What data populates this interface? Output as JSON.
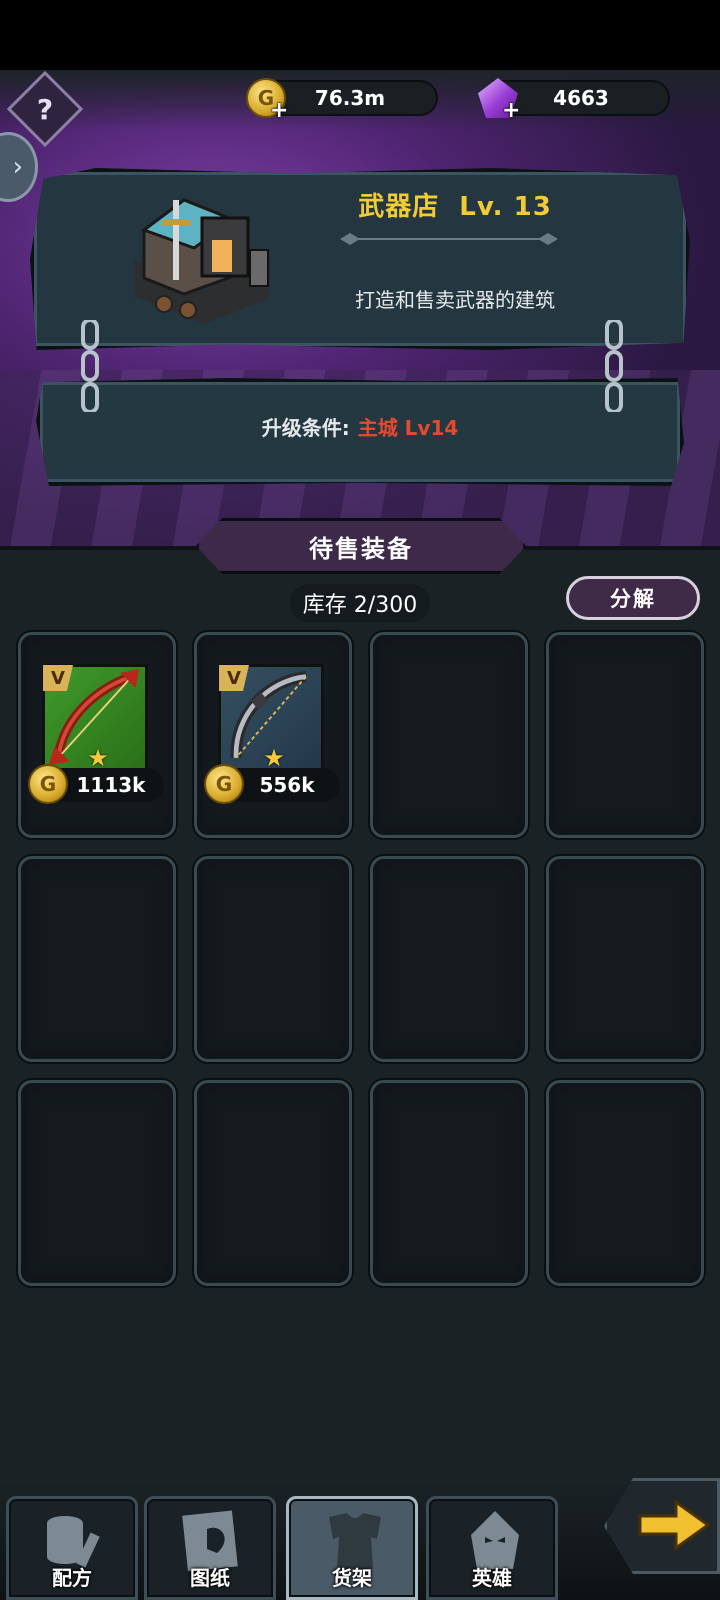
{
  "currencies": {
    "gold": "76.3m",
    "gems": "4663"
  },
  "building": {
    "name": "武器店",
    "level": "Lv. 13",
    "description": "打造和售卖武器的建筑"
  },
  "upgrade": {
    "label": "升级条件:",
    "requirement": "主城 Lv14"
  },
  "section": {
    "title": "待售装备",
    "stock": "库存 2/300",
    "decompose_label": "分解"
  },
  "items": [
    {
      "grade": "V",
      "price": "1113k",
      "rarity": "green",
      "stars": 1
    },
    {
      "grade": "V",
      "price": "556k",
      "rarity": "blue",
      "stars": 1
    }
  ],
  "nav": {
    "tabs": [
      {
        "label": "配方",
        "icon": "recipe-icon"
      },
      {
        "label": "图纸",
        "icon": "blueprint-icon"
      },
      {
        "label": "货架",
        "icon": "shelf-icon",
        "active": true
      },
      {
        "label": "英雄",
        "icon": "hero-icon"
      }
    ]
  },
  "colors": {
    "accent_gold": "#f2cc35",
    "requirement_red": "#e64a2e",
    "panel": "#243740"
  }
}
